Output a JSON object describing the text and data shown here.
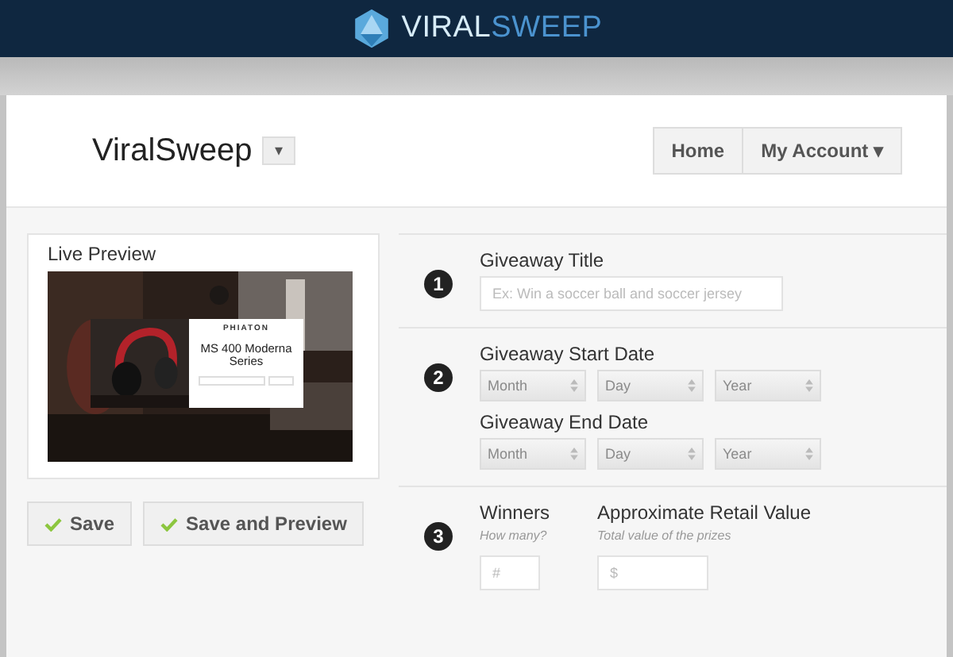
{
  "top_bar": {
    "logo": {
      "text_1": "VIRAL",
      "text_2": "SWEEP"
    }
  },
  "header": {
    "title": "ViralSweep",
    "dropdown_symbol": "▾",
    "nav": [
      {
        "label": "Home",
        "kind": "link"
      },
      {
        "label": "My Account ▾",
        "kind": "menu"
      }
    ]
  },
  "preview": {
    "title": "Live Preview",
    "card": {
      "brand": "PHIATON",
      "product": "MS 400 Moderna Series"
    }
  },
  "buttons": [
    {
      "label": "Save"
    },
    {
      "label": "Save and Preview"
    }
  ],
  "steps": [
    {
      "number": "1",
      "fields": [
        {
          "kind": "text",
          "label": "Giveaway Title",
          "placeholder": "Ex: Win a soccer ball and soccer jersey"
        }
      ]
    },
    {
      "number": "2",
      "fields": [
        {
          "kind": "date",
          "label": "Giveaway Start Date",
          "selects": [
            {
              "placeholder": "Month",
              "disabled": true
            },
            {
              "placeholder": "Day",
              "disabled": true
            },
            {
              "placeholder": "Year",
              "disabled": true
            }
          ]
        },
        {
          "kind": "date",
          "label": "Giveaway End Date",
          "selects": [
            {
              "placeholder": "Month",
              "disabled": true
            },
            {
              "placeholder": "Day",
              "disabled": true
            },
            {
              "placeholder": "Year",
              "disabled": true
            }
          ]
        }
      ]
    },
    {
      "number": "3",
      "fields": [
        {
          "kind": "small",
          "label": "Winners",
          "hint": "How many?",
          "placeholder": "#"
        },
        {
          "kind": "medium",
          "label": "Approximate Retail Value",
          "hint": "Total value of the prizes",
          "placeholder": "$"
        }
      ]
    }
  ]
}
